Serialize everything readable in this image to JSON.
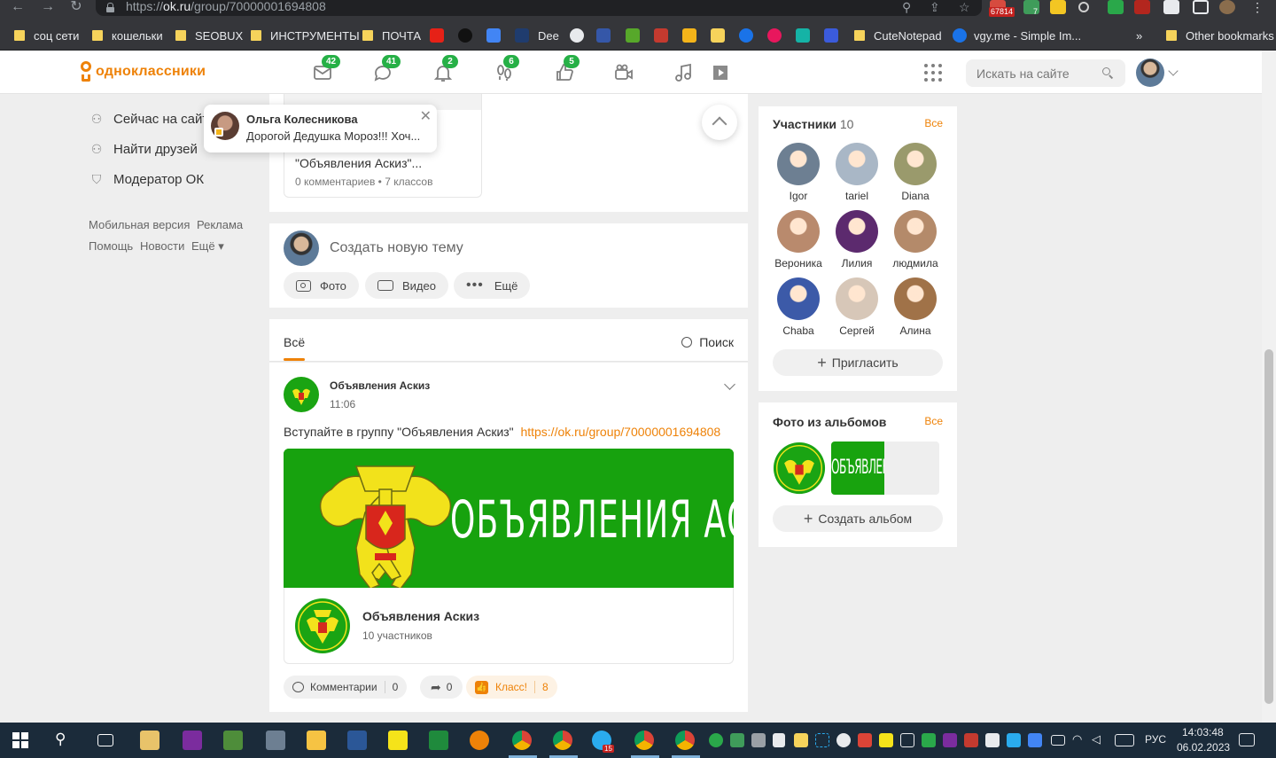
{
  "browser": {
    "url_prefix": "https://",
    "url_domain": "ok.ru",
    "url_path": "/group/70000001694808",
    "ext_badge_mail": "67814",
    "ext_badge_check": "7",
    "bookmarks": [
      {
        "label": "соц сети",
        "type": "folder"
      },
      {
        "label": "кошельки",
        "type": "folder"
      },
      {
        "label": "SEOBUX",
        "type": "folder"
      },
      {
        "label": "ИНСТРУМЕНТЫ",
        "type": "folder"
      },
      {
        "label": "ПОЧТА",
        "type": "folder"
      },
      {
        "label": "Dee",
        "type": "link"
      },
      {
        "label": "CuteNotepad",
        "type": "folder"
      },
      {
        "label": "vgy.me - Simple Im...",
        "type": "link"
      },
      {
        "label": "»",
        "type": "more"
      },
      {
        "label": "Other bookmarks",
        "type": "folder"
      }
    ]
  },
  "header": {
    "logo_text": "одноклассники",
    "badges": {
      "messages": "42",
      "discussions": "41",
      "notifications": "2",
      "guests": "6",
      "events": "5"
    },
    "search_placeholder": "Искать на сайте"
  },
  "left_menu": {
    "items": [
      {
        "label": "Сейчас на сайте"
      },
      {
        "label": "Найти друзей"
      },
      {
        "label": "Модератор ОК"
      }
    ],
    "links": [
      "Мобильная версия",
      "Реклама",
      "Помощь",
      "Новости",
      "Ещё"
    ]
  },
  "notification": {
    "name": "Ольга Колесникова",
    "text": "Дорогой Дедушка Мороз!!! Хоч..."
  },
  "top_post_preview": {
    "title": "\"Объявления Аскиз\"...",
    "meta": "0 комментариев • 7 классов"
  },
  "composer": {
    "placeholder": "Создать новую тему",
    "photo": "Фото",
    "video": "Видео",
    "more": "Ещё"
  },
  "feed": {
    "tab_all": "Всё",
    "search": "Поиск"
  },
  "post": {
    "author": "Объявления Аскиз",
    "time": "11:06",
    "text": "Вступайте в группу \"Объявления Аскиз\"",
    "link": "https://ok.ru/group/70000001694808",
    "banner_text": "ОБЪЯВЛЕНИЯ АСКИЗ",
    "logo_text": "ОБЪЯВЛЕНИЯ АСКИЗ",
    "group_name": "Объявления Аскиз",
    "group_members": "10 участников",
    "comments_label": "Комментарии",
    "comments_count": "0",
    "shares_count": "0",
    "klass_label": "Класс!",
    "klass_count": "8"
  },
  "members": {
    "title": "Участники",
    "count": "10",
    "all": "Все",
    "people": [
      {
        "name": "Igor",
        "color": "#6d7f92"
      },
      {
        "name": "tariel",
        "color": "#a9b7c6"
      },
      {
        "name": "Diana",
        "color": "#9a9a6c"
      },
      {
        "name": "Вероника",
        "color": "#b98a6d"
      },
      {
        "name": "Лилия",
        "color": "#5c2a6e"
      },
      {
        "name": "людмила",
        "color": "#b48a6a"
      },
      {
        "name": "Chaba",
        "color": "#3c5aa8"
      },
      {
        "name": "Сергей",
        "color": "#d7c7b8"
      },
      {
        "name": "Алина",
        "color": "#a07248"
      }
    ],
    "invite": "Пригласить"
  },
  "albums": {
    "title": "Фото из альбомов",
    "all": "Все",
    "create": "Создать альбом",
    "thumb_text": "ОБЪЯВЛЕН"
  },
  "taskbar": {
    "lang": "РУС",
    "time": "14:03:48",
    "date": "06.02.2023",
    "telegram_badge": "15"
  },
  "colors": {
    "ok_orange": "#ee8208",
    "badge_green": "#26b046",
    "banner_green": "#18a30e",
    "link_orange": "#ee8208"
  }
}
